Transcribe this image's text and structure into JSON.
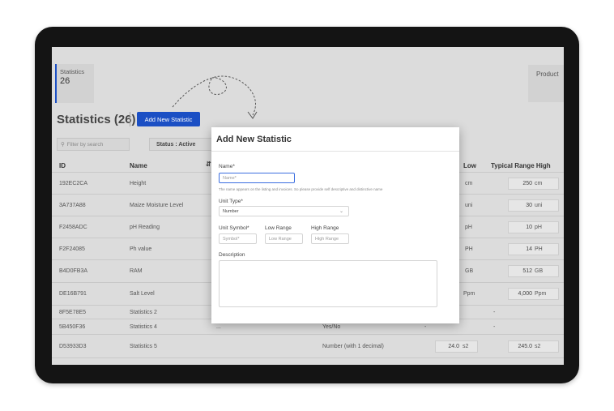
{
  "summary": {
    "statistics": {
      "label": "Statistics",
      "count": "26"
    },
    "products_label": "Product"
  },
  "page": {
    "title": "Statistics (26)",
    "add_button": "Add New Statistic",
    "filter_placeholder": "Filter by search",
    "status_filter": "Status : Active"
  },
  "table": {
    "headers": {
      "id": "ID",
      "name": "Name",
      "low": "Low",
      "typical_high": "Typical Range High"
    },
    "rows": [
      {
        "id": "192EC2CA",
        "name": "Height",
        "type": "",
        "low": "",
        "low_unit": "cm",
        "high": "250",
        "high_unit": "cm"
      },
      {
        "id": "3A737A88",
        "name": "Maize Moisture Level",
        "type": "",
        "low": "",
        "low_unit": "uni",
        "high": "30",
        "high_unit": "uni"
      },
      {
        "id": "F2458ADC",
        "name": "pH Reading",
        "type": "",
        "low": "",
        "low_unit": "pH",
        "high": "10",
        "high_unit": "pH"
      },
      {
        "id": "F2F24085",
        "name": "Ph value",
        "type": "",
        "low": "",
        "low_unit": "PH",
        "high": "14",
        "high_unit": "PH"
      },
      {
        "id": "B4D0FB3A",
        "name": "RAM",
        "type": "",
        "low": "",
        "low_unit": "GB",
        "high": "512",
        "high_unit": "GB"
      },
      {
        "id": "DE16B791",
        "name": "Salt Level",
        "type": "",
        "low": "",
        "low_unit": "Ppm",
        "high": "4,000",
        "high_unit": "Ppm"
      },
      {
        "id": "8F5E78E5",
        "name": "Statistics 2",
        "type": "",
        "low": "",
        "low_unit": "",
        "high": "",
        "high_unit": "",
        "high_dash": "-"
      },
      {
        "id": "5B450F36",
        "name": "Statistics 4",
        "desc": "...",
        "type": "Yes/No",
        "low": "",
        "low_unit": "",
        "low_dash": "-",
        "high": "",
        "high_unit": "",
        "high_dash": "-"
      },
      {
        "id": "D53933D3",
        "name": "Statistics 5",
        "type": "Number (with 1 decimal)",
        "low": "24.0",
        "low_unit": "s2",
        "high": "245.0",
        "high_unit": "s2"
      }
    ]
  },
  "modal": {
    "title": "Add New Statistic",
    "name_label": "Name*",
    "name_placeholder": "Name*",
    "name_hint": "The name appears on the listing and invoices. So please provide self descriptive and distinctive name",
    "unit_type_label": "Unit Type*",
    "unit_type_value": "Number",
    "unit_symbol_label": "Unit Symbol*",
    "unit_symbol_placeholder": "Symbol*",
    "low_range_label": "Low Range",
    "low_range_placeholder": "Low Range",
    "high_range_label": "High Range",
    "high_range_placeholder": "High Range",
    "description_label": "Description"
  },
  "colors": {
    "accent": "#1b4fc4",
    "device_frame": "#141414",
    "overlay_page": "#dcdcdc"
  },
  "icons": [
    "search-icon",
    "sort-icon",
    "chevron-down-icon",
    "dashed-arrow-icon"
  ]
}
